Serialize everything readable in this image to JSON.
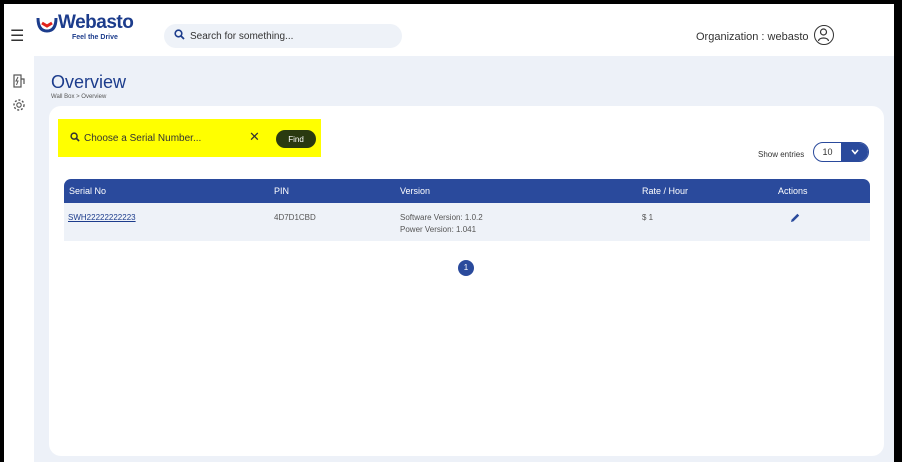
{
  "header": {
    "menu_icon": "hamburger-menu-icon",
    "logo_text": "Webasto",
    "logo_tagline": "Feel the Drive",
    "search_placeholder": "Search for something...",
    "organization_text": "Organization : webasto",
    "profile_icon": "user-avatar-icon"
  },
  "sidebar": {
    "items": [
      {
        "icon": "ev-charger-icon"
      },
      {
        "icon": "settings-gear-icon"
      }
    ]
  },
  "page": {
    "title": "Overview",
    "breadcrumb": "Wall Box > Overview"
  },
  "serial_search": {
    "placeholder": "Choose a Serial Number...",
    "find_label": "Find",
    "highlight_color": "#ffff00"
  },
  "entries": {
    "label": "Show entries",
    "value": "10"
  },
  "table": {
    "columns": [
      "Serial No",
      "PIN",
      "Version",
      "Rate / Hour",
      "Actions"
    ],
    "rows": [
      {
        "serial": "SWH22222222223",
        "pin": "4D7D1CBD",
        "software_version": "Software Version: 1.0.2",
        "power_version": "Power Version: 1.041",
        "rate": "$ 1"
      }
    ]
  },
  "pagination": {
    "current_page": "1"
  },
  "colors": {
    "brand_blue": "#1c3c8c",
    "header_blue": "#2a4a9c",
    "find_button": "#2a3a10",
    "background": "#edf1f8"
  }
}
